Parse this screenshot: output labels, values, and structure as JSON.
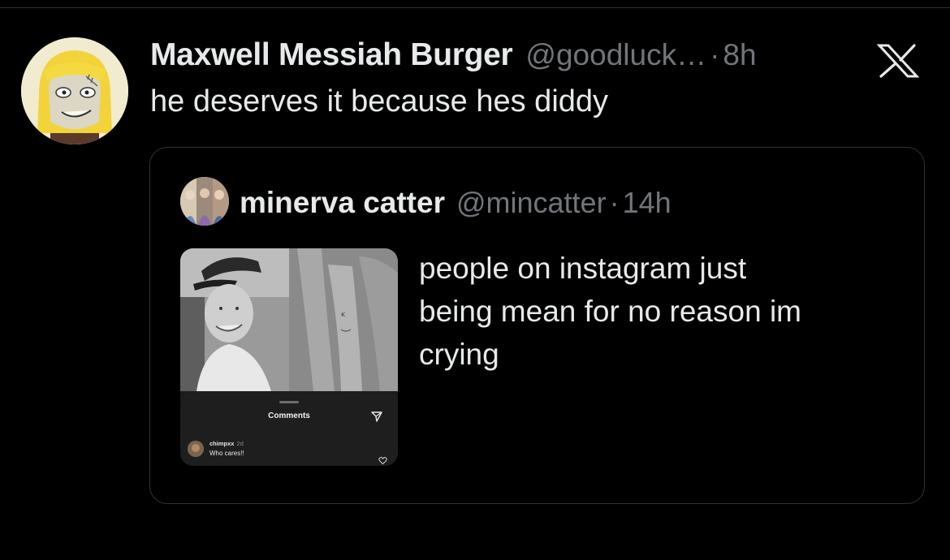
{
  "tweet": {
    "author_name": "Maxwell Messiah Burger",
    "author_handle": "@goodluck…",
    "separator": "·",
    "time": "8h",
    "text": "he deserves it because hes diddy"
  },
  "quoted_tweet": {
    "author_name": "minerva catter",
    "author_handle": "@mincatter",
    "separator": "·",
    "time": "14h",
    "text_lines": [
      "people on instagram just",
      "being mean for no reason im",
      "crying"
    ],
    "media": {
      "sheet_title": "Comments",
      "comment": {
        "username": "chimpxx",
        "age": "2d",
        "text": "Who cares!!"
      }
    }
  },
  "icons": {
    "brand": "x-logo-icon",
    "share": "share-icon",
    "like": "heart-icon"
  }
}
